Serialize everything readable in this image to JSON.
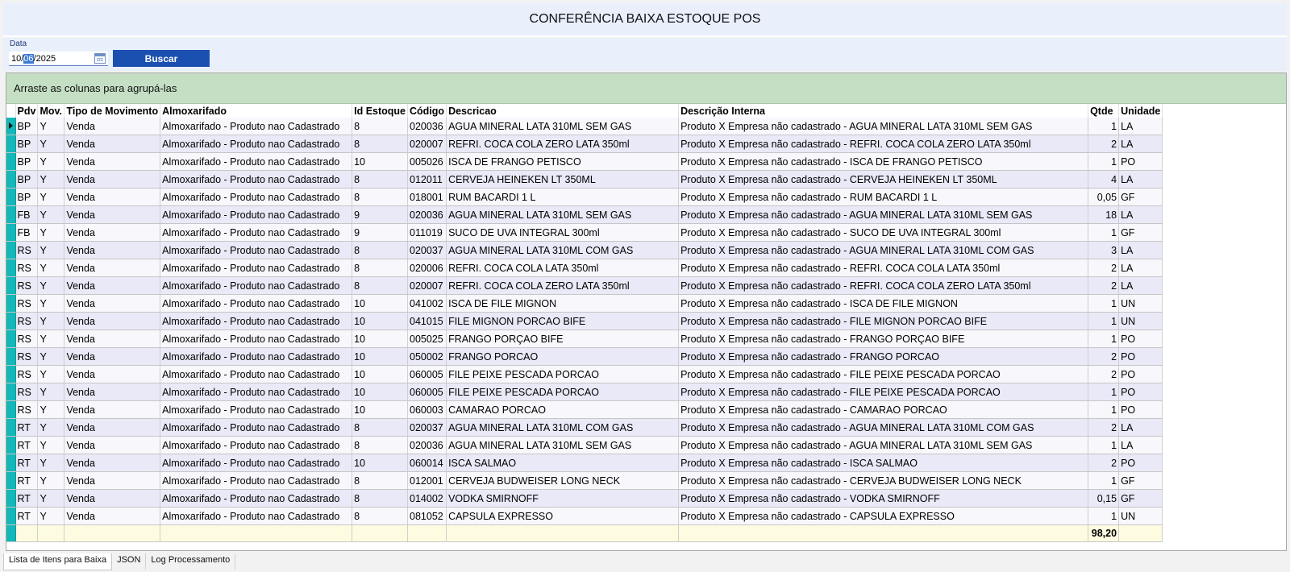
{
  "title": "CONFERÊNCIA BAIXA ESTOQUE POS",
  "filter": {
    "date_label": "Data",
    "date_day": "10/",
    "date_month": "06",
    "date_year": "/2025",
    "search_button": "Buscar"
  },
  "grid": {
    "group_hint": "Arraste as colunas para agrupá-las",
    "columns": [
      "Pdv",
      "Mov.",
      "Tipo de Movimento",
      "Almoxarifado",
      "Id Estoque",
      "Código",
      "Descricao",
      "Descrição Interna",
      "Qtde",
      "Unidade"
    ],
    "rows": [
      [
        "BP",
        "Y",
        "Venda",
        "Almoxarifado - Produto nao Cadastrado",
        "8",
        "020036",
        "AGUA MINERAL LATA 310ML SEM GAS",
        "Produto X Empresa não cadastrado - AGUA MINERAL LATA 310ML SEM GAS",
        "1",
        "LA"
      ],
      [
        "BP",
        "Y",
        "Venda",
        "Almoxarifado - Produto nao Cadastrado",
        "8",
        "020007",
        "REFRI. COCA COLA ZERO LATA 350ml",
        "Produto X Empresa não cadastrado - REFRI. COCA COLA ZERO LATA 350ml",
        "2",
        "LA"
      ],
      [
        "BP",
        "Y",
        "Venda",
        "Almoxarifado - Produto nao Cadastrado",
        "10",
        "005026",
        "ISCA DE FRANGO PETISCO",
        "Produto X Empresa não cadastrado - ISCA DE FRANGO PETISCO",
        "1",
        "PO"
      ],
      [
        "BP",
        "Y",
        "Venda",
        "Almoxarifado - Produto nao Cadastrado",
        "8",
        "012011",
        "CERVEJA HEINEKEN LT 350ML",
        "Produto X Empresa não cadastrado - CERVEJA HEINEKEN LT 350ML",
        "4",
        "LA"
      ],
      [
        "BP",
        "Y",
        "Venda",
        "Almoxarifado - Produto nao Cadastrado",
        "8",
        "018001",
        "RUM BACARDI 1 L",
        "Produto X Empresa não cadastrado - RUM BACARDI 1 L",
        "0,05",
        "GF"
      ],
      [
        "FB",
        "Y",
        "Venda",
        "Almoxarifado - Produto nao Cadastrado",
        "9",
        "020036",
        "AGUA MINERAL LATA 310ML SEM GAS",
        "Produto X Empresa não cadastrado - AGUA MINERAL LATA 310ML SEM GAS",
        "18",
        "LA"
      ],
      [
        "FB",
        "Y",
        "Venda",
        "Almoxarifado - Produto nao Cadastrado",
        "9",
        "011019",
        "SUCO DE UVA INTEGRAL 300ml",
        "Produto X Empresa não cadastrado - SUCO DE UVA INTEGRAL 300ml",
        "1",
        "GF"
      ],
      [
        "RS",
        "Y",
        "Venda",
        "Almoxarifado - Produto nao Cadastrado",
        "8",
        "020037",
        "AGUA MINERAL LATA 310ML COM GAS",
        "Produto X Empresa não cadastrado - AGUA MINERAL LATA 310ML COM GAS",
        "3",
        "LA"
      ],
      [
        "RS",
        "Y",
        "Venda",
        "Almoxarifado - Produto nao Cadastrado",
        "8",
        "020006",
        "REFRI. COCA COLA LATA 350ml",
        "Produto X Empresa não cadastrado - REFRI. COCA COLA LATA 350ml",
        "2",
        "LA"
      ],
      [
        "RS",
        "Y",
        "Venda",
        "Almoxarifado - Produto nao Cadastrado",
        "8",
        "020007",
        "REFRI. COCA COLA ZERO LATA 350ml",
        "Produto X Empresa não cadastrado - REFRI. COCA COLA ZERO LATA 350ml",
        "2",
        "LA"
      ],
      [
        "RS",
        "Y",
        "Venda",
        "Almoxarifado - Produto nao Cadastrado",
        "10",
        "041002",
        "ISCA DE FILE MIGNON",
        "Produto X Empresa não cadastrado - ISCA DE FILE MIGNON",
        "1",
        "UN"
      ],
      [
        "RS",
        "Y",
        "Venda",
        "Almoxarifado - Produto nao Cadastrado",
        "10",
        "041015",
        "FILE MIGNON PORCAO BIFE",
        "Produto X Empresa não cadastrado - FILE MIGNON PORCAO BIFE",
        "1",
        "UN"
      ],
      [
        "RS",
        "Y",
        "Venda",
        "Almoxarifado - Produto nao Cadastrado",
        "10",
        "005025",
        "FRANGO PORÇAO BIFE",
        "Produto X Empresa não cadastrado - FRANGO PORÇAO BIFE",
        "1",
        "PO"
      ],
      [
        "RS",
        "Y",
        "Venda",
        "Almoxarifado - Produto nao Cadastrado",
        "10",
        "050002",
        "FRANGO PORCAO",
        "Produto X Empresa não cadastrado - FRANGO PORCAO",
        "2",
        "PO"
      ],
      [
        "RS",
        "Y",
        "Venda",
        "Almoxarifado - Produto nao Cadastrado",
        "10",
        "060005",
        "FILE PEIXE PESCADA PORCAO",
        "Produto X Empresa não cadastrado - FILE PEIXE PESCADA PORCAO",
        "2",
        "PO"
      ],
      [
        "RS",
        "Y",
        "Venda",
        "Almoxarifado - Produto nao Cadastrado",
        "10",
        "060005",
        "FILE PEIXE PESCADA PORCAO",
        "Produto X Empresa não cadastrado - FILE PEIXE PESCADA PORCAO",
        "1",
        "PO"
      ],
      [
        "RS",
        "Y",
        "Venda",
        "Almoxarifado - Produto nao Cadastrado",
        "10",
        "060003",
        "CAMARAO PORCAO",
        "Produto X Empresa não cadastrado - CAMARAO PORCAO",
        "1",
        "PO"
      ],
      [
        "RT",
        "Y",
        "Venda",
        "Almoxarifado - Produto nao Cadastrado",
        "8",
        "020037",
        "AGUA MINERAL LATA 310ML COM GAS",
        "Produto X Empresa não cadastrado - AGUA MINERAL LATA 310ML COM GAS",
        "2",
        "LA"
      ],
      [
        "RT",
        "Y",
        "Venda",
        "Almoxarifado - Produto nao Cadastrado",
        "8",
        "020036",
        "AGUA MINERAL LATA 310ML SEM GAS",
        "Produto X Empresa não cadastrado - AGUA MINERAL LATA 310ML SEM GAS",
        "1",
        "LA"
      ],
      [
        "RT",
        "Y",
        "Venda",
        "Almoxarifado - Produto nao Cadastrado",
        "10",
        "060014",
        "ISCA SALMAO",
        "Produto X Empresa não cadastrado - ISCA SALMAO",
        "2",
        "PO"
      ],
      [
        "RT",
        "Y",
        "Venda",
        "Almoxarifado - Produto nao Cadastrado",
        "8",
        "012001",
        "CERVEJA BUDWEISER LONG NECK",
        "Produto X Empresa não cadastrado - CERVEJA BUDWEISER LONG NECK",
        "1",
        "GF"
      ],
      [
        "RT",
        "Y",
        "Venda",
        "Almoxarifado - Produto nao Cadastrado",
        "8",
        "014002",
        "VODKA SMIRNOFF",
        "Produto X Empresa não cadastrado - VODKA SMIRNOFF",
        "0,15",
        "GF"
      ],
      [
        "RT",
        "Y",
        "Venda",
        "Almoxarifado - Produto nao Cadastrado",
        "8",
        "081052",
        "CAPSULA EXPRESSO",
        "Produto X Empresa não cadastrado - CAPSULA EXPRESSO",
        "1",
        "UN"
      ]
    ],
    "total_qtde": "98,20"
  },
  "tabs": [
    {
      "label": "Lista de Itens para Baixa"
    },
    {
      "label": "JSON"
    },
    {
      "label": "Log Processamento"
    }
  ],
  "colors": {
    "header_bg": "#e9f0fc",
    "button_bg": "#1c50b0",
    "group_bar_bg": "#c5dfc4",
    "row_indicator": "#14b8b8",
    "total_row_bg": "#fdfbe0"
  }
}
